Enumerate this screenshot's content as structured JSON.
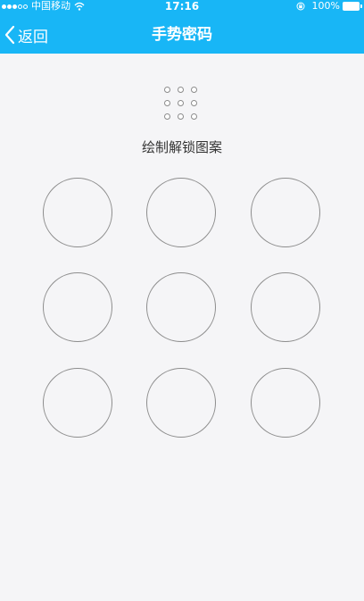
{
  "status_bar": {
    "carrier": "中国移动",
    "time": "17:16",
    "battery": "100%",
    "signal_bars_filled": 3,
    "signal_bars_total": 5
  },
  "nav": {
    "back_label": "返回",
    "title": "手势密码"
  },
  "instruction": "绘制解锁图案",
  "pattern_grid": {
    "rows": 3,
    "cols": 3
  },
  "colors": {
    "header_bg": "#18b6f6",
    "page_bg": "#f5f5f7",
    "circle_stroke": "#8d8d8d"
  }
}
